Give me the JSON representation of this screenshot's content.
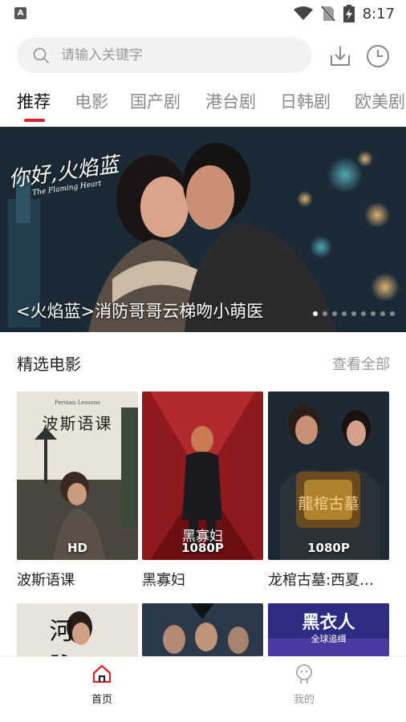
{
  "status_bar": {
    "app_badge": "A",
    "time": "8:17"
  },
  "search": {
    "placeholder": "请输入关键字"
  },
  "tabs": [
    {
      "label": "推荐",
      "active": true
    },
    {
      "label": "电影",
      "active": false
    },
    {
      "label": "国产剧",
      "active": false
    },
    {
      "label": "港台剧",
      "active": false
    },
    {
      "label": "日韩剧",
      "active": false
    },
    {
      "label": "欧美剧",
      "active": false
    }
  ],
  "banner": {
    "logo": "你好,火焰蓝",
    "logo_sub": "The Flaming Heart",
    "caption": "<火焰蓝>消防哥哥云梯吻小萌医",
    "dot_count": 9,
    "active_dot": 0
  },
  "section": {
    "title": "精选电影",
    "more": "查看全部"
  },
  "movies": [
    {
      "title": "波斯语课",
      "badge": "HD",
      "art_title": "波斯语课",
      "art_sub": "Persian Lessons"
    },
    {
      "title": "黑寡妇",
      "badge": "1080P",
      "art_title": "黑寡妇"
    },
    {
      "title": "龙棺古墓:西夏…",
      "badge": "1080P",
      "art_title": "龍棺古墓"
    },
    {
      "title": "",
      "badge": "",
      "art_title": "河 脉"
    },
    {
      "title": "",
      "badge": ""
    },
    {
      "title": "",
      "badge": "",
      "art_title": "黑衣人",
      "art_sub": "全球追缉"
    }
  ],
  "bottom_nav": [
    {
      "label": "首页",
      "active": true
    },
    {
      "label": "我的",
      "active": false
    }
  ],
  "colors": {
    "accent": "#d8232a",
    "active_text": "#111111",
    "inactive_text": "#8a8a8a"
  }
}
